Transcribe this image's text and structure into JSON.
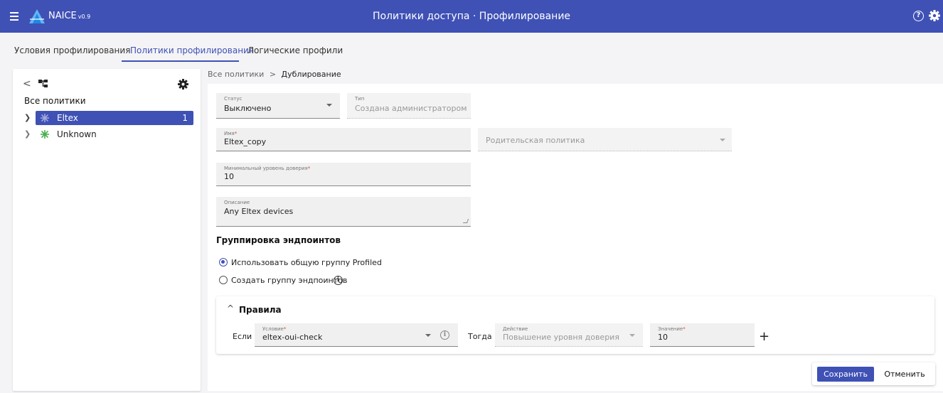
{
  "app": {
    "name": "NAICE",
    "version": "v0.9",
    "title": "Политики доступа · Профилирование",
    "help_glyph": "?",
    "accent_color": "#3f51b5"
  },
  "tabs": [
    {
      "label": "Условия профилирования",
      "active": false
    },
    {
      "label": "Политики профилирования",
      "active": true
    },
    {
      "label": "Логические профили",
      "active": false
    }
  ],
  "sidebar": {
    "back_glyph": "<",
    "heading": "Все политики",
    "nodes": [
      {
        "label": "Eltex",
        "count": "1",
        "selected": true,
        "icon": "network-node-icon",
        "icon_color": "#9fa8da"
      },
      {
        "label": "Unknown",
        "count": "",
        "selected": false,
        "icon": "network-node-icon",
        "icon_color": "#4caf50"
      }
    ]
  },
  "breadcrumb": {
    "root": "Все политики",
    "separator": ">",
    "current": "Дублирование"
  },
  "form": {
    "status": {
      "label": "Статус",
      "value": "Выключено"
    },
    "type": {
      "label": "Тип",
      "value": "Создана администратором"
    },
    "name": {
      "label": "Имя",
      "required_mark": "*",
      "value": "Eltex_copy"
    },
    "parent": {
      "placeholder": "Родительская политика"
    },
    "min_trust": {
      "label": "Минимальный уровень доверия",
      "required_mark": "*",
      "value": "10"
    },
    "description": {
      "label": "Описание",
      "value": "Any Eltex devices"
    }
  },
  "grouping": {
    "title": "Группировка эндпоинтов",
    "options": [
      {
        "label": "Использовать общую группу Profiled",
        "selected": true
      },
      {
        "label": "Создать группу эндпоинтов",
        "selected": false
      }
    ],
    "info_glyph": "i"
  },
  "rules": {
    "title": "Правила",
    "collapse_glyph": "^",
    "if_label": "Если",
    "then_label": "Тогда",
    "condition": {
      "label": "Условие",
      "required_mark": "*",
      "value": "eltex-oui-check"
    },
    "action": {
      "label": "Действие",
      "value": "Повышение уровня доверия"
    },
    "value": {
      "label": "Значение",
      "required_mark": "*",
      "value": "10"
    },
    "add_glyph": "+",
    "info_glyph": "i"
  },
  "buttons": {
    "save": "Сохранить",
    "cancel": "Отменить"
  }
}
